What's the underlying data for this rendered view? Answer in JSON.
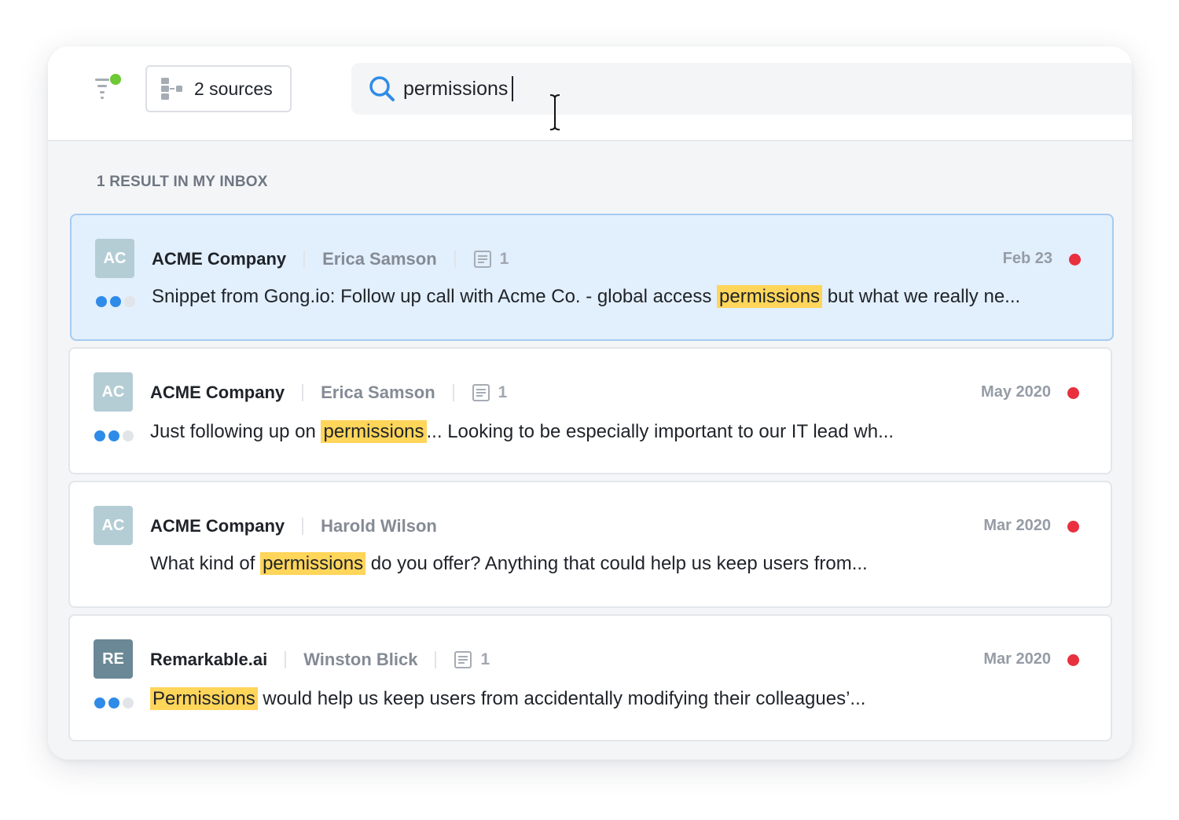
{
  "colors": {
    "accent_blue": "#2f8be8",
    "highlight": "#ffd55a",
    "unread": "#e8303f",
    "online": "#6dc935",
    "dot_inactive": "#e1e4e8"
  },
  "toolbar": {
    "filter_icon": "filter-icon",
    "sources_icon": "sources-tree-icon",
    "sources_label": "2 sources",
    "search_icon": "search-icon",
    "search_value": "permissions"
  },
  "results": {
    "heading": "1 RESULT IN MY INBOX",
    "cards": [
      {
        "initials": "AC",
        "avatar_color": "#b4cdd5",
        "company": "ACME Company",
        "contact": "Erica Samson",
        "doc_count": "1",
        "date": "Feb 23",
        "stage_filled": 2,
        "snippet_before": "Snippet from Gong.io: Follow up call with Acme Co. - global access ",
        "snippet_match": "permissions",
        "snippet_after": " but what we really ne..."
      },
      {
        "initials": "AC",
        "avatar_color": "#b4cdd5",
        "company": "ACME Company",
        "contact": "Erica Samson",
        "doc_count": "1",
        "date": "May 2020",
        "stage_filled": 2,
        "snippet_before": "Just following up on ",
        "snippet_match": "permissions",
        "snippet_after": "... Looking to be especially important to our IT lead wh..."
      },
      {
        "initials": "AC",
        "avatar_color": "#b4cdd5",
        "company": "ACME Company",
        "contact": "Harold Wilson",
        "doc_count": "",
        "date": "Mar 2020",
        "stage_filled": 0,
        "snippet_before": "What kind of ",
        "snippet_match": "permissions",
        "snippet_after": " do you offer? Anything that could help us keep users from..."
      },
      {
        "initials": "RE",
        "avatar_color": "#6b8896",
        "company": "Remarkable.ai",
        "contact": "Winston Blick",
        "doc_count": "1",
        "date": "Mar 2020",
        "stage_filled": 2,
        "snippet_before": "",
        "snippet_match": "Permissions",
        "snippet_after": " would help us keep users from accidentally modifying their colleagues’..."
      }
    ]
  }
}
